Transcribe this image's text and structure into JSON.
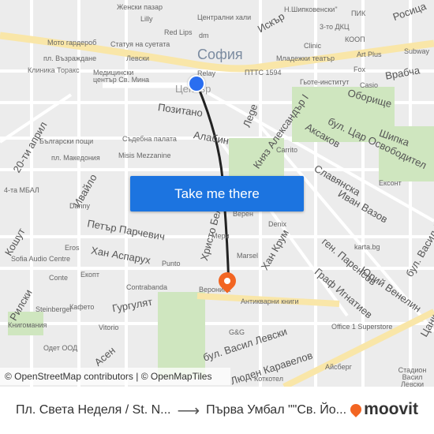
{
  "map": {
    "city_label": "София",
    "labels": [
      "Женски пазар",
      "Lilly",
      "Red Lips",
      "dm",
      "Централни хали",
      "Искър",
      "Н.Шипковенски\"",
      "ПИК",
      "Росица",
      "3-то ДКЦ",
      "КООП",
      "Clinic",
      "Мото гардероб",
      "Статуя на суетата",
      "Левски",
      "пл. Възраждане",
      "Младежки театър",
      "Art Plus",
      "Subway",
      "Клиника Торакс",
      "Медицински център Св. Мина",
      "Relay",
      "ПТТС 1594",
      "Гьоте-институт",
      "Fox",
      "Врабча",
      "Casio",
      "Център",
      "Позитано",
      "Оборище",
      "Лege",
      "Княз Александър I",
      "Шипка",
      "бул. Цар Освободител",
      "Аксаков",
      "Алабин",
      "Съдебна палата",
      "Carrito",
      "Misis Mezzanine",
      "Български пощи",
      "пл. Македония",
      "20-ти април",
      "Славянска",
      "Иван Вазов",
      "Ексонт",
      "4-та МБАЛ",
      "Ивайло",
      "Danny",
      "Петър Парчевич",
      "Христо Белчев",
      "Верен",
      "Denix",
      "Хан Крум",
      "karta.bg",
      "бул. Васил Левски",
      "Кошут",
      "Sofia Audio Centre",
      "Eros",
      "Хан Аспарух",
      "Punto",
      "Мери",
      "Marsel",
      "ген. Паренсов",
      "Юрий Венелин",
      "Граф Игнатиев",
      "Conte",
      "Contrabanda",
      "Вероника",
      "Антикварни книги",
      "Екопт",
      "Гургулят",
      "Рилски",
      "Steinberger",
      "Кафето",
      "Книгомания",
      "Vitorio",
      "Одет ООД",
      "G&G",
      "Office 1 Superstore",
      "Асен",
      "бул. Васил Левски",
      "Люден Каравелов",
      "Айсберг",
      "Коткотел",
      "Стадион Васил Левски",
      "Цанков"
    ],
    "route_color": "#222222",
    "origin_color": "#2a6ef0",
    "destination_color": "#f26522"
  },
  "attribution": "© OpenStreetMap contributors | © OpenMapTiles",
  "cta": {
    "label": "Take me there",
    "color": "#1c74e0"
  },
  "footer": {
    "from": "Пл. Света Неделя / St. N...",
    "arrow": "⟶",
    "to": "Първа Умбал \"\"Св. Йо...",
    "brand": "moovit",
    "brand_color": "#f26522"
  }
}
